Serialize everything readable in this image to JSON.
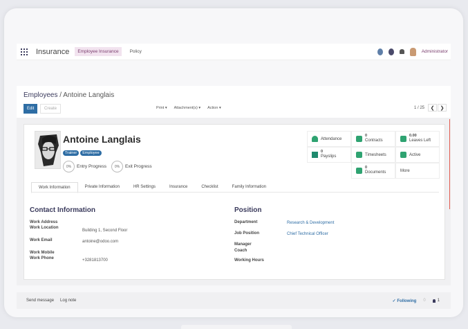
{
  "nav": {
    "app_name": "Insurance",
    "menu": [
      "Employee Insurance",
      "Policy"
    ],
    "user": "Administrator"
  },
  "control": {
    "breadcrumb_parent": "Employees",
    "breadcrumb_sep": "/",
    "breadcrumb_current": "Antoine Langlais",
    "edit": "Edit",
    "create": "Create",
    "print": "Print ▾",
    "attachments": "Attachment(s) ▾",
    "action": "Action ▾",
    "pager": "1 / 25",
    "prev": "❮",
    "next": "❯"
  },
  "employee": {
    "name": "Antoine Langlais",
    "tags": [
      "Trainer",
      "Employee"
    ],
    "entry_pct": "0%",
    "entry_label": "Entry Progress",
    "exit_pct": "0%",
    "exit_label": "Exit Progress"
  },
  "smart_buttons": {
    "attendance": "Attendance",
    "contracts_count": "0",
    "contracts": "Contracts",
    "leaves_count": "0.00",
    "leaves": "Leaves Left",
    "payslips_count": "0",
    "payslips": "Payslips",
    "timesheets": "Timesheets",
    "active": "Active",
    "documents_count": "0",
    "documents": "Documents",
    "more": "More"
  },
  "tabs": [
    "Work Information",
    "Private Information",
    "HR Settings",
    "Insurance",
    "Checklist",
    "Family Information"
  ],
  "contact": {
    "title": "Contact Information",
    "work_address_label": "Work Address",
    "work_location_label": "Work Location",
    "work_location": "Building 1, Second Floor",
    "work_email_label": "Work Email",
    "work_email": "antoine@odoo.com",
    "work_mobile_label": "Work Mobile",
    "work_phone_label": "Work Phone",
    "work_phone": "+3281813700"
  },
  "position": {
    "title": "Position",
    "department_label": "Department",
    "department": "Research & Development",
    "job_label": "Job Position",
    "job": "Chief Technical Officer",
    "manager_label": "Manager",
    "coach_label": "Coach",
    "hours_label": "Working Hours"
  },
  "chatter": {
    "send": "Send message",
    "log": "Log note",
    "following": "✓ Following",
    "following_count": "0",
    "followers": "1"
  }
}
